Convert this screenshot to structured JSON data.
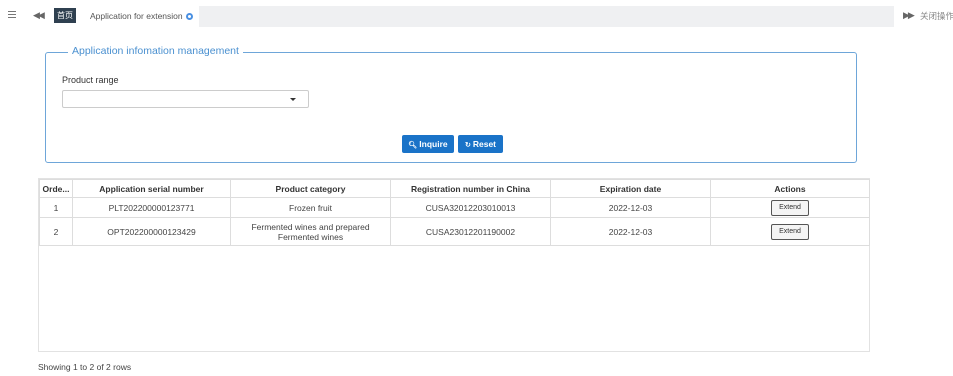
{
  "topbar": {
    "home_tab": "首页",
    "active_tab": "Application for extension",
    "nav_left": "◀◀",
    "nav_right": "▶▶",
    "close_ops": "关闭操作"
  },
  "panel": {
    "legend": "Application infomation management",
    "product_range_label": "Product range",
    "product_range_value": "",
    "inquire_label": "Inquire",
    "reset_label": "Reset"
  },
  "table": {
    "headers": [
      "Orde...",
      "Application serial number",
      "Product category",
      "Registration number in China",
      "Expiration date",
      "Actions"
    ],
    "rows": [
      {
        "order": "1",
        "serial": "PLT202200000123771",
        "category": "Frozen fruit",
        "registration": "CUSA32012203010013",
        "expiration": "2022-12-03",
        "action": "Extend"
      },
      {
        "order": "2",
        "serial": "OPT202200000123429",
        "category": "Fermented wines and prepared Fermented wines",
        "registration": "CUSA23012201190002",
        "expiration": "2022-12-03",
        "action": "Extend"
      }
    ]
  },
  "footer": {
    "pagination_text": "Showing 1 to 2 of 2 rows"
  },
  "colors": {
    "accent": "#1a73c8",
    "panel_border": "#6ea6d9",
    "home_tab_bg": "#2f4050"
  }
}
